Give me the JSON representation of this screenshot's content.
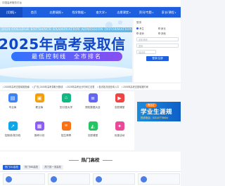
{
  "topbar": {
    "text": "中国高考服务平台"
  },
  "nav": {
    "items": [
      {
        "label": "[切换]",
        "chevron": true,
        "selected": true
      },
      {
        "label": "首页",
        "chevron": false,
        "selected": false
      },
      {
        "label": "志愿填报",
        "chevron": true,
        "selected": false
      },
      {
        "label": "找学数据",
        "chevron": true,
        "selected": false
      },
      {
        "label": "查大学",
        "chevron": true,
        "selected": false
      },
      {
        "label": "志愿课堂",
        "chevron": true,
        "selected": false
      },
      {
        "label": "资讯/专题",
        "chevron": true,
        "selected": false
      },
      {
        "label": "家长/课程",
        "chevron": true,
        "selected": false
      }
    ]
  },
  "banner": {
    "ribbon": "2024 COLLEGE ENTRANCE EXAMINATION ADMISSION INFORMATION",
    "headline": "2025年高考录取信",
    "pill": "最低控制线　全市排名"
  },
  "login": {
    "title": "登录",
    "radios": [
      {
        "label": "考生",
        "on": true
      },
      {
        "label": "家长",
        "on": false
      },
      {
        "label": "老师",
        "on": false
      },
      {
        "label": "其他",
        "on": false
      }
    ],
    "fields": [
      "手机号码",
      "密码",
      "验证码"
    ],
    "button": "登录/注册"
  },
  "ticker": [
    "2025年高考志愿填报指南",
    "[广东] 2025年高考录取分数线",
    "2025年高考出分时间汇总表",
    "各省批次线查询入口",
    "2025年高考志愿填报时间"
  ],
  "tiles": [
    {
      "label": "专业库",
      "icon": "book-icon",
      "glyph": "▤",
      "color": "#3b82f6"
    },
    {
      "label": "职业库",
      "icon": "briefcase-icon",
      "glyph": "▣",
      "color": "#f59e0b"
    },
    {
      "label": "历分查大学",
      "icon": "school-icon",
      "glyph": "⌂",
      "color": "#10b981"
    },
    {
      "label": "院校数据大全",
      "icon": "database-icon",
      "glyph": "≣",
      "color": "#6366f1"
    },
    {
      "label": "志愿课堂",
      "icon": "play-icon",
      "glyph": "▶",
      "color": "#ef4444"
    },
    {
      "label": "控制线/批次线",
      "icon": "chart-icon",
      "glyph": "↗",
      "color": "#0ea5e9"
    },
    {
      "label": "报考计划",
      "icon": "calendar-icon",
      "glyph": "▦",
      "color": "#8b5cf6"
    },
    {
      "label": "招生简章",
      "icon": "document-icon",
      "glyph": "≡",
      "color": "#f97316"
    },
    {
      "label": "志愿课堂",
      "icon": "graduation-cap-icon",
      "glyph": "◭",
      "color": "#22c55e"
    },
    {
      "label": "优惠活动",
      "icon": "gift-icon",
      "glyph": "✦",
      "color": "#ec4899"
    }
  ],
  "promo": {
    "badge": "青志汇",
    "big": "学业生涯规",
    "tel": "热线电话：023-67778604"
  },
  "hot": {
    "heading": "热门高校",
    "tabs": [
      {
        "label": "热门211高校",
        "selected": true
      },
      {
        "label": "热门985高校",
        "selected": false
      },
      {
        "label": "热门双一流高校",
        "selected": false
      }
    ]
  }
}
